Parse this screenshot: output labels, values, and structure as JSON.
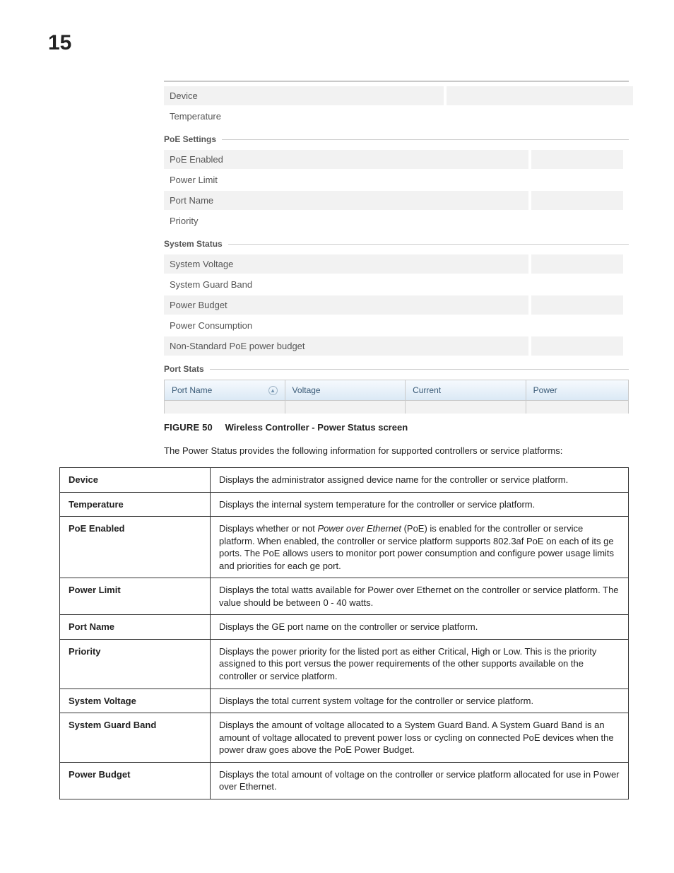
{
  "page_number": "15",
  "screenshot": {
    "top_rows": {
      "device_label": "Device",
      "device_value": "",
      "temperature_label": "Temperature",
      "temperature_value": ""
    },
    "poe_section_title": "PoE Settings",
    "poe_rows": {
      "enabled_label": "PoE Enabled",
      "enabled_value": "",
      "limit_label": "Power Limit",
      "limit_value": "",
      "portname_label": "Port Name",
      "portname_value": "",
      "priority_label": "Priority",
      "priority_value": ""
    },
    "sys_section_title": "System Status",
    "sys_rows": {
      "voltage_label": "System Voltage",
      "voltage_value": "",
      "guardband_label": "System Guard Band",
      "guardband_value": "",
      "budget_label": "Power Budget",
      "budget_value": "",
      "consumption_label": "Power Consumption",
      "consumption_value": "",
      "nonstd_label": "Non-Standard PoE power budget",
      "nonstd_value": ""
    },
    "portstats_section_title": "Port Stats",
    "portstats_headers": {
      "portname": "Port Name",
      "voltage": "Voltage",
      "current": "Current",
      "power": "Power"
    }
  },
  "figure": {
    "label": "FIGURE 50",
    "title": "Wireless Controller - Power Status screen"
  },
  "intro": "The Power Status provides the following information for supported controllers or service platforms:",
  "definitions": [
    {
      "term": "Device",
      "desc": "Displays the administrator assigned device name for the controller or service platform."
    },
    {
      "term": "Temperature",
      "desc": "Displays the internal system temperature for the controller or service platform."
    },
    {
      "term": "PoE Enabled",
      "desc_html": "Displays whether or not <em>Power over Ethernet</em> (PoE) is enabled for the controller or service platform. When enabled, the controller or service platform supports 802.3af PoE on each of its ge ports. The PoE allows users to monitor port power consumption and configure power usage limits and priorities for each ge port."
    },
    {
      "term": "Power Limit",
      "desc": "Displays the total watts available for Power over Ethernet on the controller or service platform. The value should be between 0 - 40 watts."
    },
    {
      "term": "Port Name",
      "desc": "Displays the GE port name on the controller or service platform."
    },
    {
      "term": "Priority",
      "desc": "Displays the power priority for the listed port as either Critical, High or Low. This is the priority assigned to this port versus the power requirements of the other supports available on the controller or service platform."
    },
    {
      "term": "System Voltage",
      "desc": "Displays the total current system voltage for the controller or service platform."
    },
    {
      "term": "System Guard Band",
      "desc": "Displays the amount of voltage allocated to a System Guard Band. A System Guard Band is an amount of voltage allocated to prevent power loss or cycling on connected PoE devices when the power draw goes above the PoE Power Budget."
    },
    {
      "term": "Power Budget",
      "desc": "Displays the total amount of voltage on the controller or service platform allocated for use in Power over Ethernet."
    }
  ]
}
